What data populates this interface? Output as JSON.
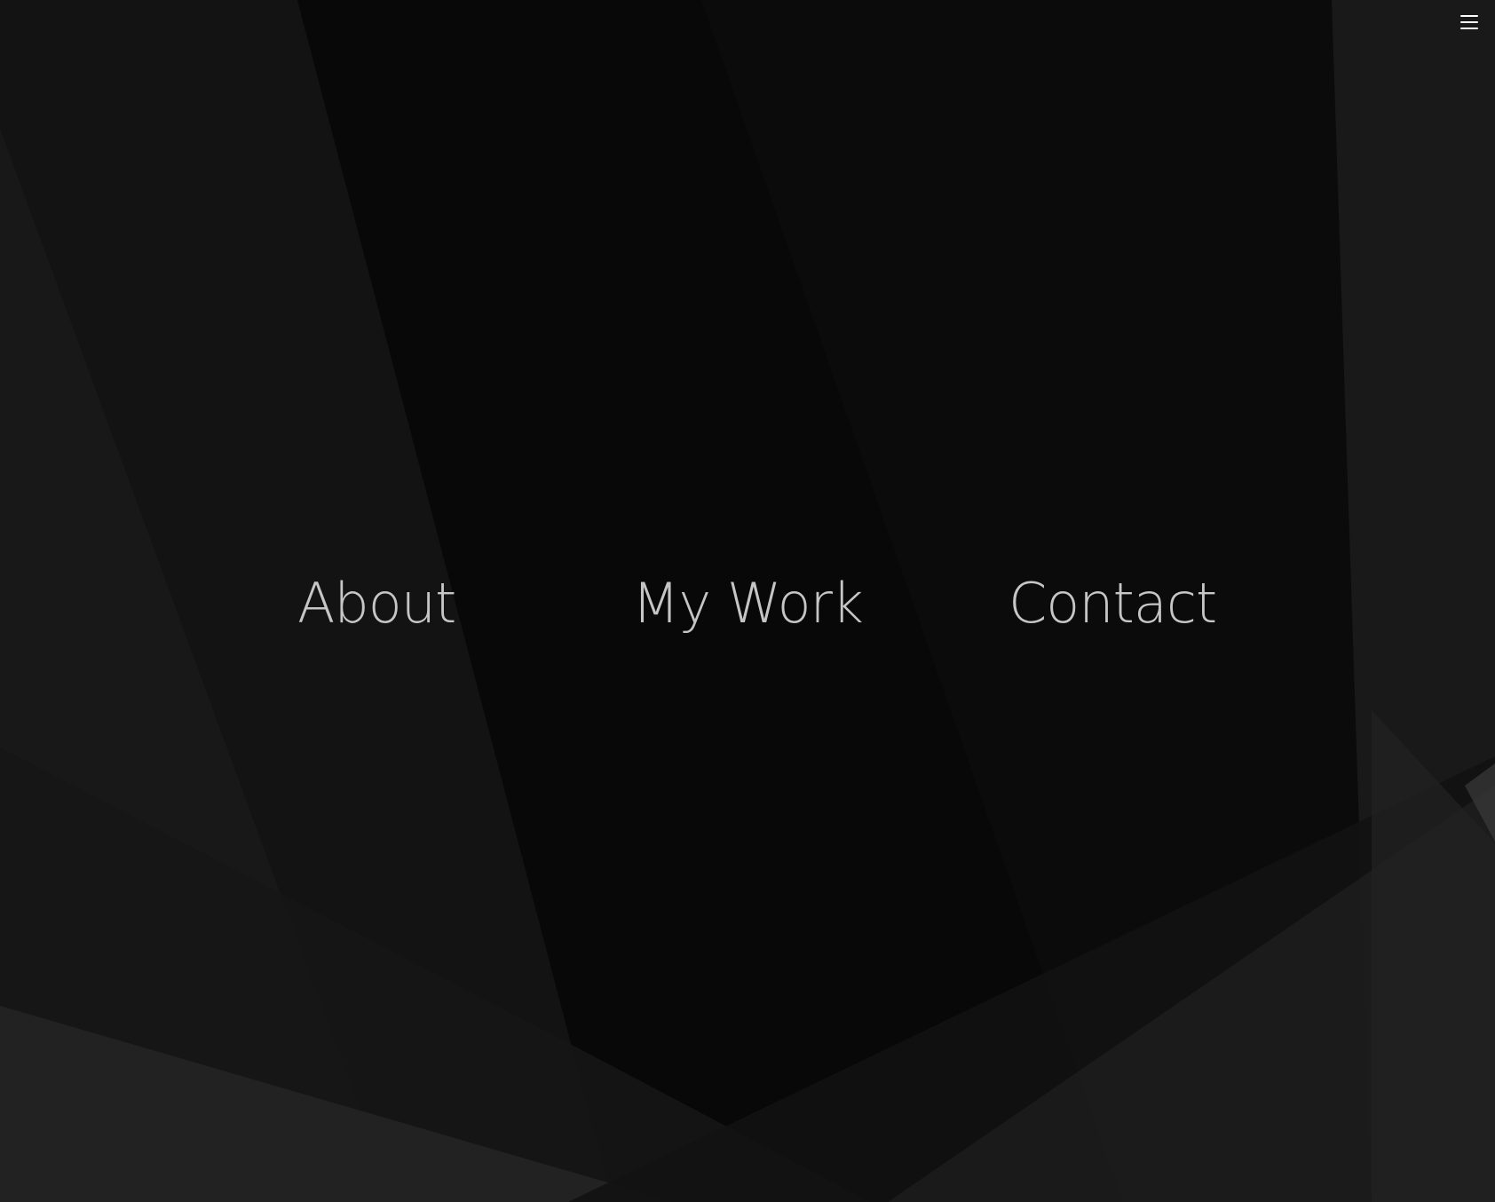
{
  "header": {
    "menu_icon": "hamburger-menu-icon"
  },
  "nav": {
    "items": [
      {
        "label": "About"
      },
      {
        "label": "My Work"
      },
      {
        "label": "Contact"
      }
    ]
  },
  "colors": {
    "background": "#0b0b0b",
    "text": "#d6d6d6",
    "icon": "#ffffff"
  }
}
